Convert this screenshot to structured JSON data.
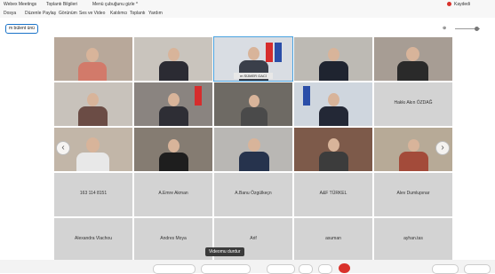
{
  "titlebar": {
    "app": "Webex Meetings",
    "meeting_info": "Toplantı Bilgileri",
    "status": "Meeting",
    "mode": "Menü çubuğunu gizle ^",
    "recording_label": "Kaydedi"
  },
  "menu": [
    "Dosya",
    "Düzenle",
    "Paylaş",
    "Görünüm",
    "Ses ve Video",
    "Katılımcı",
    "Toplantı",
    "Yardım"
  ],
  "active_speaker": "m bülent ünü",
  "zoom": {
    "label": "⊕"
  },
  "tiles": [
    {
      "label": ""
    },
    {
      "label": ""
    },
    {
      "label": "m SÜMER GACİ"
    },
    {
      "label": ""
    },
    {
      "label": ""
    },
    {
      "label": ""
    },
    {
      "label": ""
    },
    {
      "label": ""
    },
    {
      "label": ""
    },
    {
      "label": "Hakkı Akın ÖZDAĞ"
    },
    {
      "label": ""
    },
    {
      "label": ""
    },
    {
      "label": ""
    },
    {
      "label": ""
    },
    {
      "label": ""
    },
    {
      "label": "163 114 8151"
    },
    {
      "label": "A.Emre Akman"
    },
    {
      "label": "A.Banu Özgülkeçn"
    },
    {
      "label": "A&F TÜRKEL"
    },
    {
      "label": "Alev Dumlupınar"
    },
    {
      "label": "Alexandra Vlachou"
    },
    {
      "label": "Andres Moya"
    },
    {
      "label": "Arif"
    },
    {
      "label": "asuman"
    },
    {
      "label": "ayhan.tas"
    }
  ],
  "tooltip": "Videomu durdur",
  "colors": {
    "accent": "#1a73c8",
    "leave": "#d9312b"
  }
}
